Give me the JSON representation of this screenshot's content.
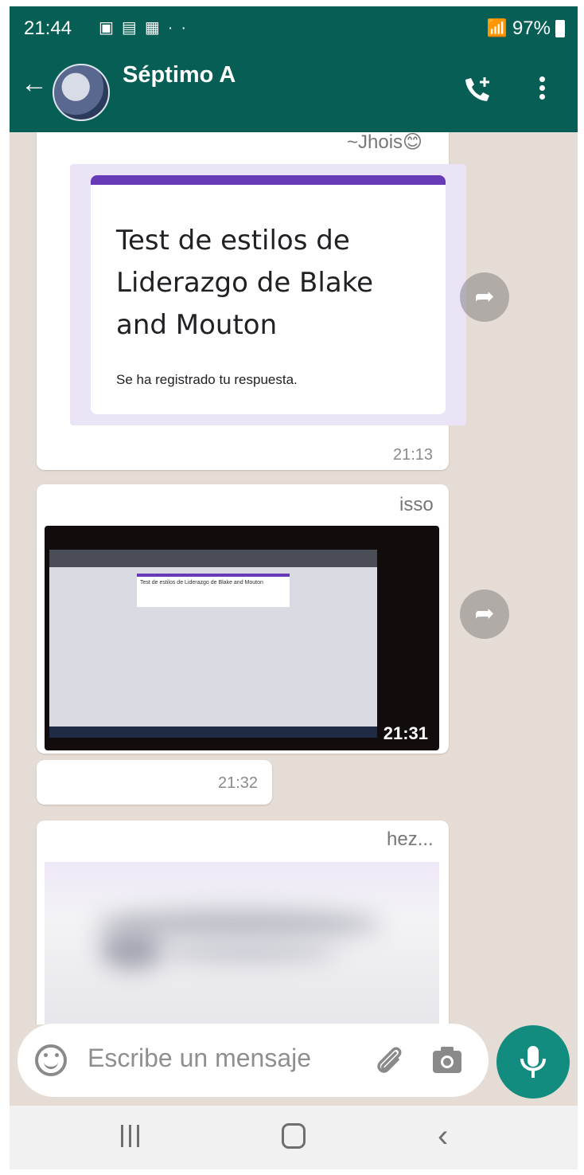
{
  "status_bar": {
    "time": "21:44",
    "notification_icons": [
      "gallery-icon",
      "card-icon",
      "calendar-icon",
      "more-dots-icon"
    ],
    "battery": "97%"
  },
  "chat": {
    "title": "Séptimo A",
    "theme_color": "#075e54",
    "accent_color": "#128c7e"
  },
  "messages": [
    {
      "sender_fragment": "~Jhois😊",
      "form": {
        "title": "Test de estilos de Liderazgo de Blake and Mouton",
        "note": "Se ha registrado tu respuesta.",
        "accent": "#673ab7"
      },
      "time": "21:13"
    },
    {
      "sender_fragment": "isso",
      "video": {
        "screen_title": "Test de estilos de Liderazgo de Blake and Mouton"
      },
      "time": "21:31"
    },
    {
      "time": "21:32"
    },
    {
      "sender_fragment": "hez..."
    }
  ],
  "composer": {
    "placeholder": "Escribe un mensaje"
  }
}
